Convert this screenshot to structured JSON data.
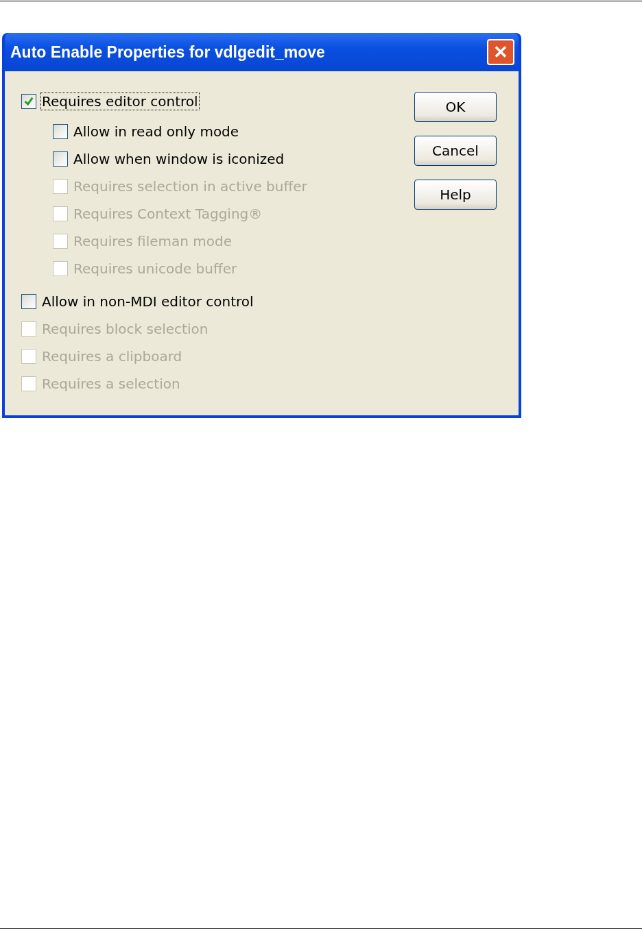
{
  "window": {
    "title": "Auto Enable Properties for vdlgedit_move",
    "close": "✕"
  },
  "options": [
    {
      "label": "Requires editor control",
      "checked": true,
      "disabled": false,
      "focused": true,
      "children": [
        {
          "label": "Allow in read only mode",
          "checked": false,
          "disabled": false,
          "focused": false
        },
        {
          "label": "Allow when window is iconized",
          "checked": false,
          "disabled": false,
          "focused": false
        },
        {
          "label": "Requires selection in active buffer",
          "checked": false,
          "disabled": true,
          "focused": false
        },
        {
          "label": "Requires Context Tagging®",
          "checked": false,
          "disabled": true,
          "focused": false
        },
        {
          "label": "Requires fileman mode",
          "checked": false,
          "disabled": true,
          "focused": false
        },
        {
          "label": "Requires unicode buffer",
          "checked": false,
          "disabled": true,
          "focused": false
        }
      ]
    },
    {
      "label": "Allow in non-MDI editor control",
      "checked": false,
      "disabled": false,
      "focused": false
    },
    {
      "label": "Requires block selection",
      "checked": false,
      "disabled": true,
      "focused": false
    },
    {
      "label": "Requires a clipboard",
      "checked": false,
      "disabled": true,
      "focused": false
    },
    {
      "label": "Requires a selection",
      "checked": false,
      "disabled": true,
      "focused": false
    }
  ],
  "buttons": [
    "OK",
    "Cancel",
    "Help"
  ]
}
